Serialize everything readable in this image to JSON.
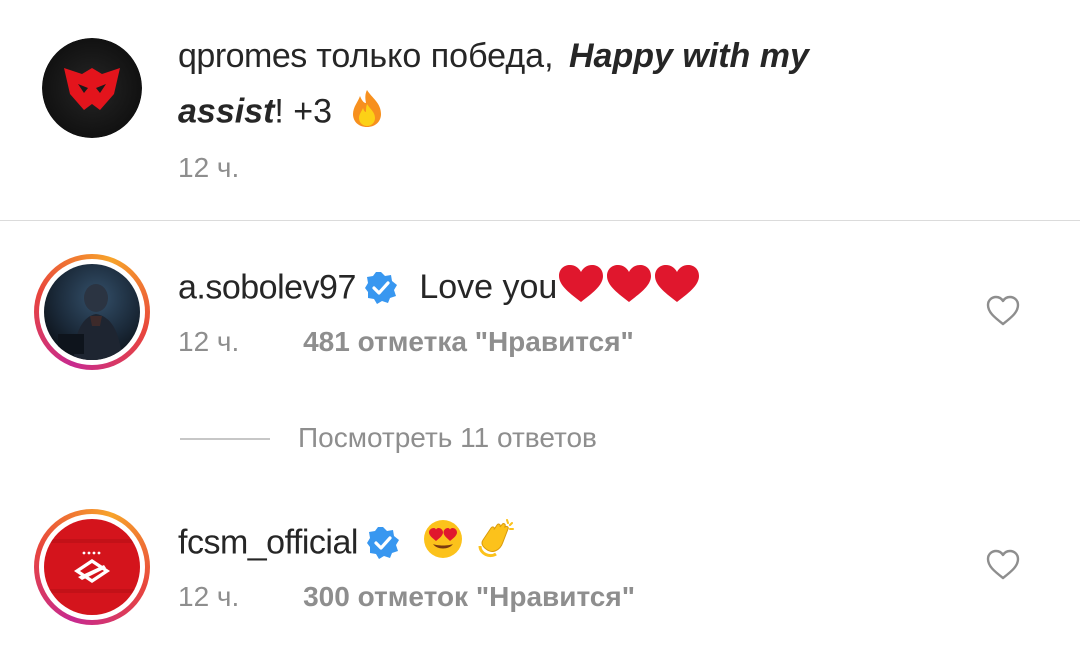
{
  "caption": {
    "username": "qpromes",
    "text_plain": "только победа,",
    "text_bold_italic_1": "Happy with my",
    "text_bold_italic_2": "assist",
    "text_tail": "! +3",
    "emoji": "fire",
    "time": "12 ч."
  },
  "comments": [
    {
      "username": "a.sobolev97",
      "verified": true,
      "text": "Love you",
      "emoji": "three red hearts",
      "time": "12 ч.",
      "likes": "481 отметка \"Нравится\""
    },
    {
      "username": "fcsm_official",
      "verified": true,
      "emoji": "heart-eyes face, clapping hands",
      "time": "12 ч.",
      "likes": "300 отметок \"Нравится\""
    }
  ],
  "replies": {
    "label": "Посмотреть 11 ответов"
  },
  "colors": {
    "primary_text": "#262626",
    "secondary_text": "#8e8e8e",
    "verified_blue": "#3897f0",
    "heart_red": "#e0172d"
  }
}
